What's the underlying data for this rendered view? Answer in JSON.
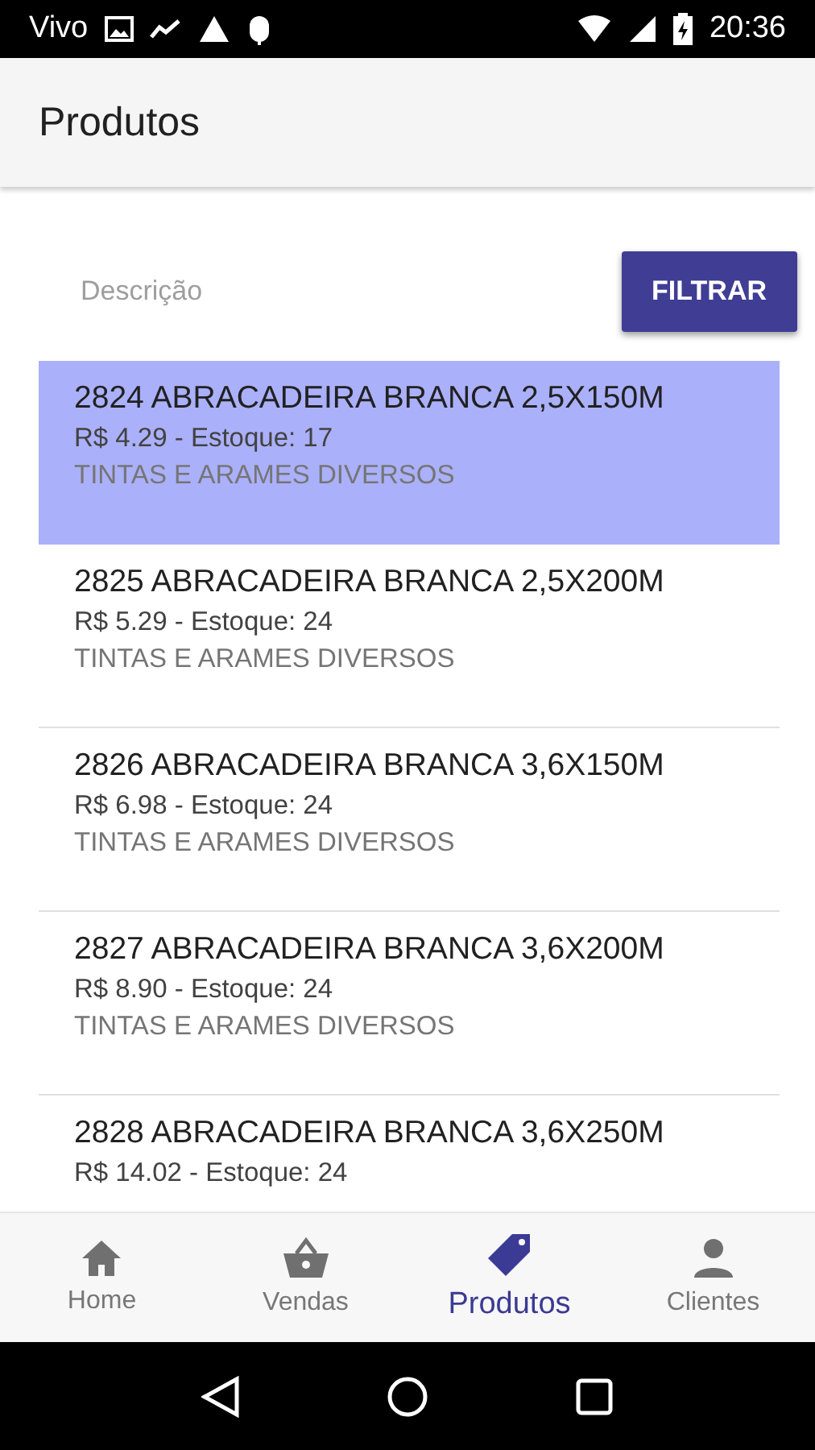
{
  "status_bar": {
    "carrier": "Vivo",
    "time": "20:36"
  },
  "app_bar": {
    "title": "Produtos"
  },
  "search": {
    "placeholder": "Descrição"
  },
  "filter_button": "FILTRAR",
  "products": [
    {
      "name": "2824 ABRACADEIRA BRANCA 2,5X150M",
      "price_stock": "R$ 4.29 - Estoque: 17",
      "category": "TINTAS E ARAMES DIVERSOS",
      "selected": true
    },
    {
      "name": "2825 ABRACADEIRA BRANCA 2,5X200M",
      "price_stock": "R$ 5.29 - Estoque: 24",
      "category": "TINTAS E ARAMES DIVERSOS",
      "selected": false
    },
    {
      "name": "2826 ABRACADEIRA BRANCA 3,6X150M",
      "price_stock": "R$ 6.98 - Estoque: 24",
      "category": "TINTAS E ARAMES DIVERSOS",
      "selected": false
    },
    {
      "name": "2827 ABRACADEIRA BRANCA 3,6X200M",
      "price_stock": "R$ 8.90 - Estoque: 24",
      "category": "TINTAS E ARAMES DIVERSOS",
      "selected": false
    },
    {
      "name": "2828 ABRACADEIRA BRANCA 3,6X250M",
      "price_stock": "R$ 14.02 - Estoque: 24",
      "selected": false
    }
  ],
  "bottom_nav": [
    {
      "kind": "home",
      "label": "Home",
      "selected": false
    },
    {
      "kind": "basket",
      "label": "Vendas",
      "selected": false
    },
    {
      "kind": "tag",
      "label": "Produtos",
      "selected": true
    },
    {
      "kind": "person",
      "label": "Clientes",
      "selected": false
    }
  ]
}
